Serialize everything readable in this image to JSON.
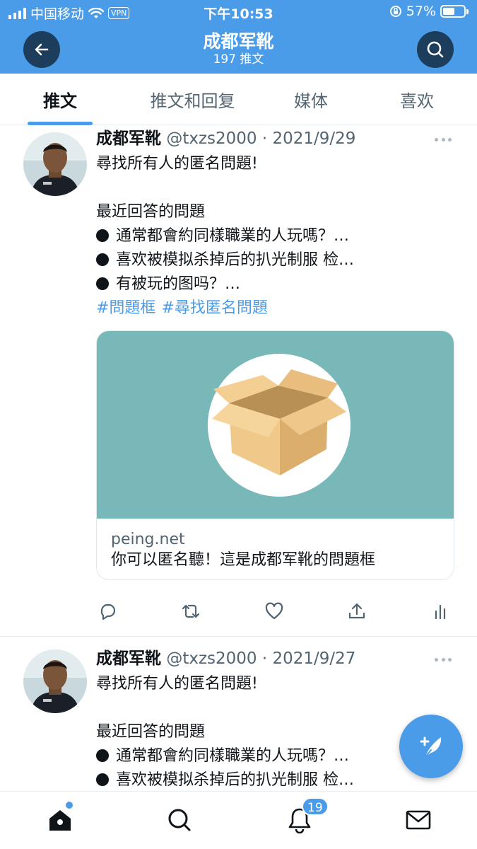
{
  "status_bar": {
    "carrier": "中国移动",
    "vpn": "VPN",
    "time": "下午10:53",
    "battery": "57%",
    "battery_level": 0.57
  },
  "header": {
    "title": "成都军靴",
    "subtitle": "197 推文"
  },
  "tabs": [
    {
      "label": "推文",
      "active": true
    },
    {
      "label": "推文和回复",
      "active": false
    },
    {
      "label": "媒体",
      "active": false
    },
    {
      "label": "喜欢",
      "active": false
    }
  ],
  "tweets": [
    {
      "name": "成都军靴",
      "meta": "@txzs2000 · 2021/9/29",
      "line1": "尋找所有人的匿名問題!",
      "line2": "最近回答的問題",
      "bullet1": "通常都會約同樣職業的人玩嗎？…",
      "bullet2": "喜欢被模拟杀掉后的扒光制服 检…",
      "bullet3": "有被玩的图吗？…",
      "hashtag1": "#問題框",
      "hashtag2": "#尋找匿名問題",
      "card": {
        "domain": "peing.net",
        "title": "你可以匿名聽！這是成都军靴的問題框",
        "image_bg": "#78b8b8"
      }
    },
    {
      "name": "成都军靴",
      "meta": "@txzs2000 · 2021/9/27",
      "line1": "尋找所有人的匿名問題!",
      "line2": "最近回答的問題",
      "bullet1": "通常都會約同樣職業的人玩嗎？…",
      "bullet2": "喜欢被模拟杀掉后的扒光制服 检…"
    }
  ],
  "bottom_nav": {
    "notifications_badge": "19"
  },
  "colors": {
    "accent": "#4a9be8",
    "header_button": "#1d3d5c"
  }
}
